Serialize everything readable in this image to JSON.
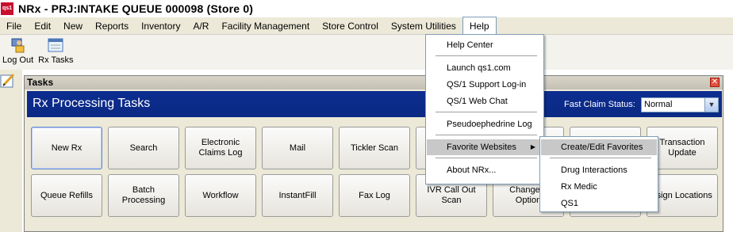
{
  "window": {
    "app_icon_text": "qs1",
    "title": "NRx - PRJ:INTAKE QUEUE 000098 (Store 0)"
  },
  "menubar": {
    "items": [
      "File",
      "Edit",
      "New",
      "Reports",
      "Inventory",
      "A/R",
      "Facility Management",
      "Store Control",
      "System Utilities",
      "Help"
    ]
  },
  "toolbar": {
    "logout_label": "Log Out",
    "rx_tasks_label": "Rx Tasks"
  },
  "tasks": {
    "caption": "Tasks",
    "header_title": "Rx Processing Tasks",
    "fast_claim_label": "Fast Claim Status:",
    "fast_claim_value": "Normal",
    "row1": [
      "New Rx",
      "Search",
      "Electronic Claims Log",
      "Mail",
      "Tickler Scan",
      "",
      "",
      "",
      "Transaction Update"
    ],
    "row2": [
      "Queue Refills",
      "Batch Processing",
      "Workflow",
      "InstantFill",
      "Fax Log",
      "IVR Call Out Scan",
      "Change L Option",
      "",
      "ssign Locations"
    ]
  },
  "help_menu": {
    "items": [
      "Help Center",
      "Launch qs1.com",
      "QS/1 Support Log-in",
      "QS/1 Web Chat",
      "Pseudoephedrine Log",
      "Favorite Websites",
      "About NRx..."
    ]
  },
  "favorites_submenu": {
    "items": [
      "Create/Edit Favorites",
      "Drug Interactions",
      "Rx Medic",
      "QS1"
    ]
  },
  "colors": {
    "header_band": "#0a2a84",
    "menu_bg": "#ece9d8",
    "highlight": "#c8c8c8"
  }
}
